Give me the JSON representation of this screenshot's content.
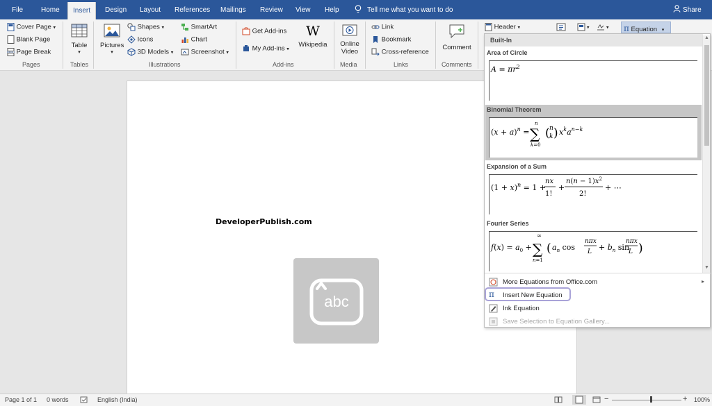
{
  "menubar": {
    "tabs": [
      "File",
      "Home",
      "Insert",
      "Design",
      "Layout",
      "References",
      "Mailings",
      "Review",
      "View",
      "Help"
    ],
    "active_tab": "Insert",
    "tell_me": "Tell me what you want to do",
    "share": "Share"
  },
  "ribbon": {
    "pages": {
      "cover_page": "Cover Page",
      "blank_page": "Blank Page",
      "page_break": "Page Break",
      "group": "Pages"
    },
    "tables": {
      "table": "Table",
      "group": "Tables"
    },
    "illustrations": {
      "pictures": "Pictures",
      "shapes": "Shapes",
      "icons": "Icons",
      "models_3d": "3D Models",
      "smartart": "SmartArt",
      "chart": "Chart",
      "screenshot": "Screenshot",
      "group": "Illustrations"
    },
    "addins": {
      "get_addins": "Get Add-ins",
      "my_addins": "My Add-ins",
      "wikipedia": "Wikipedia",
      "group": "Add-ins"
    },
    "media": {
      "online_video_1": "Online",
      "online_video_2": "Video",
      "group": "Media"
    },
    "links": {
      "link": "Link",
      "bookmark": "Bookmark",
      "cross_reference": "Cross-reference",
      "group": "Links"
    },
    "comments": {
      "comment": "Comment",
      "group": "Comments"
    },
    "header": "Header",
    "equation": "Equation"
  },
  "document": {
    "text": "DeveloperPublish.com"
  },
  "equation_panel": {
    "heading": "Built-In",
    "sections": [
      {
        "title": "Area of Circle"
      },
      {
        "title": "Binomial Theorem"
      },
      {
        "title": "Expansion of a Sum"
      },
      {
        "title": "Fourier Series"
      }
    ],
    "menu": [
      {
        "label": "More Equations from Office.com"
      },
      {
        "label": "Insert New Equation"
      },
      {
        "label": "Ink Equation"
      },
      {
        "label": "Save Selection to Equation Gallery..."
      }
    ]
  },
  "statusbar": {
    "page": "Page 1 of 1",
    "words": "0 words",
    "language": "English (India)",
    "zoom": "100%"
  },
  "colors": {
    "brand": "#2b579a",
    "ribbon": "#f3f3f3",
    "focus": "#a9a3d8"
  }
}
